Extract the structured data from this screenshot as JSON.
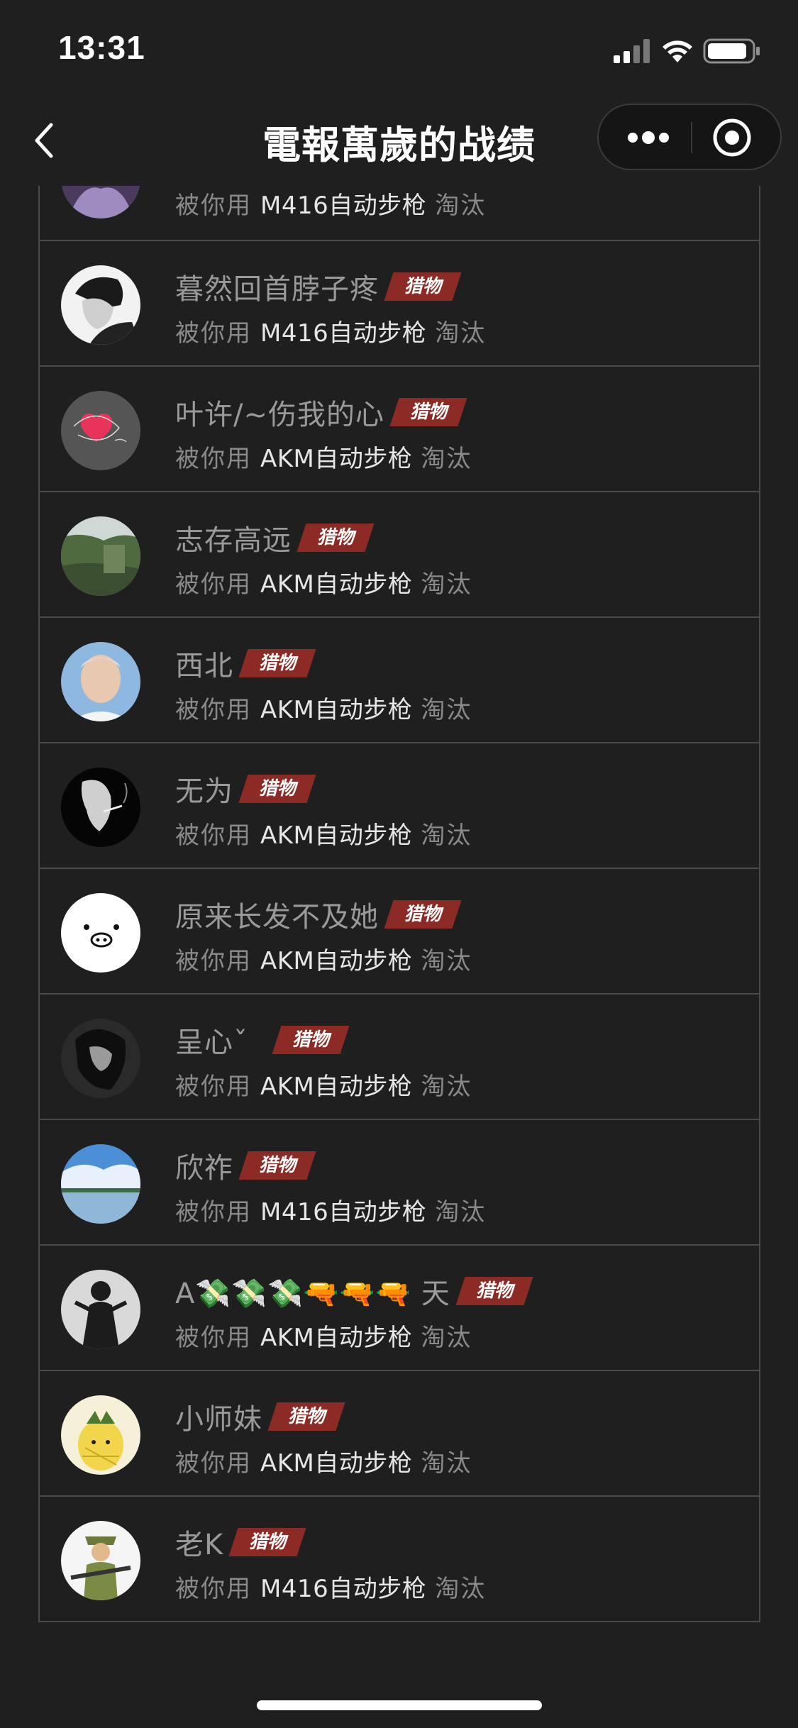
{
  "status": {
    "time": "13:31"
  },
  "nav": {
    "title": "電報萬歲的战绩",
    "back_icon": "chevron-left-icon",
    "more_icon": "more-dots-icon",
    "target_icon": "target-icon"
  },
  "colors": {
    "background": "#1f1f1f",
    "tag": "#8c2b25",
    "divider": "#4a4a4a"
  },
  "kill_prefix": "被你用",
  "kill_suffix": "淘汰",
  "tag_label": "猎物",
  "partial_row": {
    "weapon": "M416自动步枪"
  },
  "kills": [
    {
      "name": "暮然回首脖子疼",
      "weapon": "M416自动步枪",
      "tag": "猎物"
    },
    {
      "name": "叶许/~伤我的心",
      "weapon": "AKM自动步枪",
      "tag": "猎物"
    },
    {
      "name": "志存高远",
      "weapon": "AKM自动步枪",
      "tag": "猎物"
    },
    {
      "name": "西北",
      "weapon": "AKM自动步枪",
      "tag": "猎物"
    },
    {
      "name": "无为",
      "weapon": "AKM自动步枪",
      "tag": "猎物"
    },
    {
      "name": "原来长发不及她",
      "weapon": "AKM自动步枪",
      "tag": "猎物"
    },
    {
      "name": "呈心ˇ",
      "weapon": "AKM自动步枪",
      "tag": "猎物"
    },
    {
      "name": "欣祚",
      "weapon": "M416自动步枪",
      "tag": "猎物"
    },
    {
      "name": "A💸💸💸🔫🔫🔫 天",
      "weapon": "AKM自动步枪",
      "tag": "猎物"
    },
    {
      "name": "小师妹",
      "weapon": "AKM自动步枪",
      "tag": "猎物"
    },
    {
      "name": "老K",
      "weapon": "M416自动步枪",
      "tag": "猎物"
    }
  ]
}
